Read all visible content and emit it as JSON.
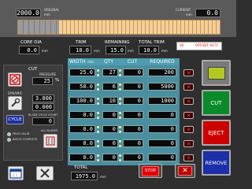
{
  "header": {
    "original_value": "2000.0",
    "original_label": "ORIGINAL",
    "current_value": "0.0",
    "current_label": "CURRENT",
    "unit": "mm"
  },
  "core_dia": {
    "label": "CORE DIA",
    "value": "0.0",
    "unit": "mm"
  },
  "trim": {
    "label": "TRIM",
    "value": "10.0",
    "unit": "mm"
  },
  "remaining": {
    "label": "REMAINING",
    "value": "15.0",
    "unit": "mm"
  },
  "total_trim": {
    "label": "TOTAL TRIM",
    "value": "10.0",
    "unit": "mm"
  },
  "status_tags": {
    "left": "VE",
    "right": "OFFSET ACTI"
  },
  "cut_panel": {
    "title": "CUT",
    "pressure_label": "PRESSURE",
    "pressure_value": "25",
    "pressure_unit": "%",
    "dynamic_label": "DYNAMIC",
    "dynamic_value_1": "3.000",
    "dynamic_value_2": "0.000",
    "cycle_label": "CYCLE",
    "blade_count_label": "BLADE CYCLE COUNT",
    "blade_count_value": "0",
    "option_1": "PROG VALID",
    "option_2": "BATCH COMPLETE",
    "all_blades_label": "ALL BLADES"
  },
  "table": {
    "headers": {
      "width": "WIDTH",
      "width_unit": "mm",
      "qty": "QTY",
      "cut": "CUT",
      "required": "REQUIRED"
    },
    "rows": [
      {
        "width": "25.0",
        "qty": "27",
        "cut": "0",
        "required": "200"
      },
      {
        "width": "50.0",
        "qty": "6",
        "cut": "0",
        "required": "5000"
      },
      {
        "width": "100.0",
        "qty": "10",
        "cut": "0",
        "required": "1000"
      },
      {
        "width": "0.0",
        "qty": "0",
        "cut": "0",
        "required": "0"
      },
      {
        "width": "0.0",
        "qty": "0",
        "cut": "0",
        "required": "0"
      },
      {
        "width": "0.0",
        "qty": "0",
        "cut": "0",
        "required": "0"
      },
      {
        "width": "0.0",
        "qty": "0",
        "cut": "0",
        "required": "0"
      }
    ]
  },
  "total": {
    "label": "TOTAL",
    "value": "1975.0",
    "unit": "mm"
  },
  "buttons": {
    "cut": "CUT",
    "eject": "EJECT",
    "remove": "REMOVE",
    "stop": "STOP"
  },
  "colors": {
    "accent_green": "#0a8a2a",
    "eject_red": "#cc0000",
    "remove_blue": "#1a2fa8",
    "lcd_bg": "#111111",
    "roll_tan": "#e8b878"
  }
}
